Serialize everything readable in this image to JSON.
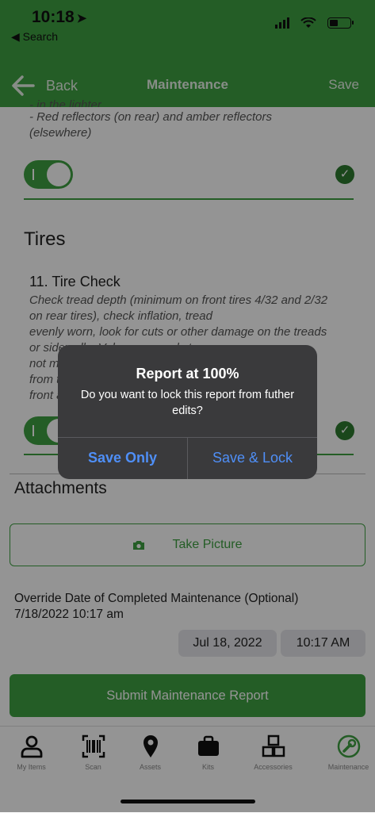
{
  "status": {
    "time": "10:18",
    "back_app": "Search"
  },
  "nav": {
    "back_label": "Back",
    "title": "Maintenance",
    "save_label": "Save"
  },
  "lights": {
    "partial_line": "- in the lighter",
    "reflectors_line1": "- Red reflectors (on rear) and amber reflectors",
    "reflectors_line2": "(elsewhere)"
  },
  "tires": {
    "section_title": "Tires",
    "item_title": "11. Tire Check",
    "desc_lines": [
      "Check tread depth (minimum on front tires 4/32 and 2/32",
      "on rear tires), check inflation, tread",
      "evenly worn, look for cuts or other damage on the treads",
      "or sidewalls. Valve caps and stems",
      "not missing, broken or damaged. Tires not separating",
      "from the rims. No foreign objects lodged between",
      "front and rear tires."
    ]
  },
  "attachments": {
    "title": "Attachments",
    "take_picture_label": "Take Picture"
  },
  "override": {
    "label": "Override Date of Completed Maintenance (Optional)",
    "value": "7/18/2022 10:17 am",
    "date_chip": "Jul 18, 2022",
    "time_chip": "10:17 AM"
  },
  "submit_label": "Submit Maintenance Report",
  "tabs": [
    {
      "label": "My Items",
      "icon": "person-icon"
    },
    {
      "label": "Scan",
      "icon": "barcode-icon"
    },
    {
      "label": "Assets",
      "icon": "map-pin-icon"
    },
    {
      "label": "Kits",
      "icon": "briefcase-icon"
    },
    {
      "label": "Accessories",
      "icon": "cubes-icon"
    },
    {
      "label": "Maintenance",
      "icon": "wrench-icon"
    }
  ],
  "dialog": {
    "title": "Report at 100%",
    "message": "Do you want to lock this report from futher edits?",
    "save_only": "Save Only",
    "save_lock": "Save & Lock"
  },
  "colors": {
    "brand_green": "#3fa042",
    "dialog_bg": "#3a3a3c",
    "dialog_button": "#4f8ff7"
  }
}
